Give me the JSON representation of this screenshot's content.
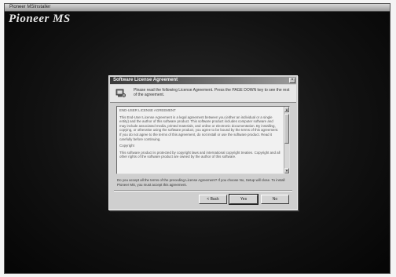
{
  "window": {
    "title": "Pioneer MSInstaller",
    "brand": "Pioneer MS"
  },
  "dialog": {
    "title": "Software License Agreement",
    "close_glyph": "×",
    "header_text": "Please read the following License Agreement. Press the PAGE DOWN key to see the rest of the agreement.",
    "license": {
      "heading": "END-USER LICENSE AGREEMENT",
      "paragraph1": "This End-User License Agreement is a legal agreement between you (either an individual or a single entity) and the author of this software product. This software product includes computer software and may include associated media, printed materials, and online or electronic documentation. By installing, copying, or otherwise using the software product, you agree to be bound by the terms of this agreement. If you do not agree to the terms of this agreement, do not install or use the software product. Read it carefully before continuing.",
      "section": "Copyright",
      "paragraph2": "This software product is protected by copyright laws and international copyright treaties. Copyright and all other rights of the software product are owned by the author of this software."
    },
    "prompt": "Do you accept all the terms of the preceding License Agreement? If you choose No, Setup will close. To install Pioneer MS, you must accept this agreement.",
    "buttons": {
      "back": "< Back",
      "yes": "Yes",
      "no": "No"
    },
    "scroll_up_glyph": "▲",
    "scroll_down_glyph": "▼"
  }
}
